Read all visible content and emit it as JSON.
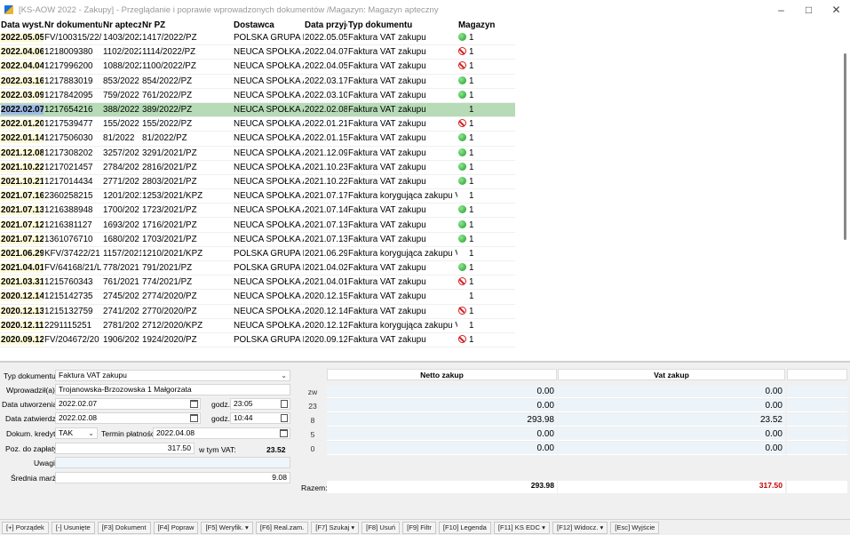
{
  "window": {
    "title": "[KS-AOW 2022 - Zakupy] - Przeglądanie i poprawie wprowadzonych dokumentów /Magazyn: Magazyn apteczny"
  },
  "grid": {
    "headers": [
      "Data wyst.",
      "Nr dokumentu",
      "Nr aptecz",
      "Nr PZ",
      "Dostawca",
      "Data przyję",
      "Typ dokumentu",
      "Magazyn"
    ],
    "rows": [
      {
        "date": "2022.05.05",
        "doc": "FV/100315/22/",
        "apt": "1403/2022",
        "pz": "1417/2022/PZ",
        "sup": "POLSKA GRUPA F",
        "recv": "2022.05.05",
        "type": "Faktura VAT zakupu",
        "status": "ok",
        "mag": "1"
      },
      {
        "date": "2022.04.06",
        "doc": "1218009380",
        "apt": "1102/2022",
        "pz": "1114/2022/PZ",
        "sup": "NEUCA SPÓŁKA A",
        "recv": "2022.04.07",
        "type": "Faktura VAT zakupu",
        "status": "no",
        "mag": "1"
      },
      {
        "date": "2022.04.04",
        "doc": "1217996200",
        "apt": "1088/2022",
        "pz": "1100/2022/PZ",
        "sup": "NEUCA SPÓŁKA A",
        "recv": "2022.04.05",
        "type": "Faktura VAT zakupu",
        "status": "no",
        "mag": "1"
      },
      {
        "date": "2022.03.16",
        "doc": "1217883019",
        "apt": "853/2022",
        "pz": "854/2022/PZ",
        "sup": "NEUCA SPÓŁKA A",
        "recv": "2022.03.17",
        "type": "Faktura VAT zakupu",
        "status": "ok",
        "mag": "1"
      },
      {
        "date": "2022.03.09",
        "doc": "1217842095",
        "apt": "759/2022",
        "pz": "761/2022/PZ",
        "sup": "NEUCA SPÓŁKA A",
        "recv": "2022.03.10",
        "type": "Faktura VAT zakupu",
        "status": "ok",
        "mag": "1"
      },
      {
        "date": "2022.02.07",
        "doc": "1217654216",
        "apt": "388/2022",
        "pz": "389/2022/PZ",
        "sup": "NEUCA SPÓŁKA A",
        "recv": "2022.02.08",
        "type": "Faktura VAT zakupu",
        "status": "none",
        "mag": "1",
        "selected": true
      },
      {
        "date": "2022.01.20",
        "doc": "1217539477",
        "apt": "155/2022",
        "pz": "155/2022/PZ",
        "sup": "NEUCA SPÓŁKA A",
        "recv": "2022.01.21",
        "type": "Faktura VAT zakupu",
        "status": "no",
        "mag": "1"
      },
      {
        "date": "2022.01.14",
        "doc": "1217506030",
        "apt": "81/2022",
        "pz": "81/2022/PZ",
        "sup": "NEUCA SPÓŁKA A",
        "recv": "2022.01.15",
        "type": "Faktura VAT zakupu",
        "status": "ok",
        "mag": "1"
      },
      {
        "date": "2021.12.08",
        "doc": "1217308202",
        "apt": "3257/202",
        "pz": "3291/2021/PZ",
        "sup": "NEUCA SPÓŁKA A",
        "recv": "2021.12.09",
        "type": "Faktura VAT zakupu",
        "status": "ok",
        "mag": "1"
      },
      {
        "date": "2021.10.22",
        "doc": "1217021457",
        "apt": "2784/202",
        "pz": "2816/2021/PZ",
        "sup": "NEUCA SPÓŁKA A",
        "recv": "2021.10.23",
        "type": "Faktura VAT zakupu",
        "status": "ok",
        "mag": "1"
      },
      {
        "date": "2021.10.21",
        "doc": "1217014434",
        "apt": "2771/202",
        "pz": "2803/2021/PZ",
        "sup": "NEUCA SPÓŁKA A",
        "recv": "2021.10.22",
        "type": "Faktura VAT zakupu",
        "status": "ok",
        "mag": "1"
      },
      {
        "date": "2021.07.16",
        "doc": "2360258215",
        "apt": "1201/2021",
        "pz": "1253/2021/KPZ",
        "sup": "NEUCA SPÓŁKA A",
        "recv": "2021.07.17",
        "type": "Faktura korygująca zakupu VA",
        "status": "none",
        "mag": "1"
      },
      {
        "date": "2021.07.13",
        "doc": "1216388948",
        "apt": "1700/202",
        "pz": "1723/2021/PZ",
        "sup": "NEUCA SPÓŁKA A",
        "recv": "2021.07.14",
        "type": "Faktura VAT zakupu",
        "status": "ok",
        "mag": "1"
      },
      {
        "date": "2021.07.12",
        "doc": "1216381127",
        "apt": "1693/202",
        "pz": "1716/2021/PZ",
        "sup": "NEUCA SPÓŁKA A",
        "recv": "2021.07.13",
        "type": "Faktura VAT zakupu",
        "status": "ok",
        "mag": "1"
      },
      {
        "date": "2021.07.12",
        "doc": "1361076710",
        "apt": "1680/202",
        "pz": "1703/2021/PZ",
        "sup": "NEUCA SPÓŁKA A",
        "recv": "2021.07.13",
        "type": "Faktura VAT zakupu",
        "status": "ok",
        "mag": "1"
      },
      {
        "date": "2021.06.29",
        "doc": "KFV/37422/21",
        "apt": "1157/2021",
        "pz": "1210/2021/KPZ",
        "sup": "POLSKA GRUPA F",
        "recv": "2021.06.29",
        "type": "Faktura korygująca zakupu VA",
        "status": "none",
        "mag": "1"
      },
      {
        "date": "2021.04.01",
        "doc": "FV/64168/21/L",
        "apt": "778/2021",
        "pz": "791/2021/PZ",
        "sup": "POLSKA GRUPA F",
        "recv": "2021.04.02",
        "type": "Faktura VAT zakupu",
        "status": "ok",
        "mag": "1"
      },
      {
        "date": "2021.03.31",
        "doc": "1215760343",
        "apt": "761/2021",
        "pz": "774/2021/PZ",
        "sup": "NEUCA SPÓŁKA A",
        "recv": "2021.04.01",
        "type": "Faktura VAT zakupu",
        "status": "no",
        "mag": "1"
      },
      {
        "date": "2020.12.14",
        "doc": "1215142735",
        "apt": "2745/202",
        "pz": "2774/2020/PZ",
        "sup": "NEUCA SPÓŁKA A",
        "recv": "2020.12.15",
        "type": "Faktura VAT zakupu",
        "status": "none",
        "mag": "1"
      },
      {
        "date": "2020.12.13",
        "doc": "1215132759",
        "apt": "2741/202",
        "pz": "2770/2020/PZ",
        "sup": "NEUCA SPÓŁKA A",
        "recv": "2020.12.14",
        "type": "Faktura VAT zakupu",
        "status": "no",
        "mag": "1"
      },
      {
        "date": "2020.12.11",
        "doc": "2291115251",
        "apt": "2781/202",
        "pz": "2712/2020/KPZ",
        "sup": "NEUCA SPÓŁKA A",
        "recv": "2020.12.12",
        "type": "Faktura korygująca zakupu VA",
        "status": "none",
        "mag": "1"
      },
      {
        "date": "2020.09.12",
        "doc": "FV/204672/20",
        "apt": "1906/202",
        "pz": "1924/2020/PZ",
        "sup": "POLSKA GRUPA F",
        "recv": "2020.09.12",
        "type": "Faktura VAT zakupu",
        "status": "no",
        "mag": "1"
      }
    ]
  },
  "form": {
    "typ_label": "Typ dokumentu:",
    "typ_value": "Faktura VAT zakupu",
    "wprow_label": "Wprowadził(a):",
    "wprow_value": "Trojanowska-Brzozowska 1 Małgorzata",
    "utw_label": "Data utworzenia:",
    "utw_value": "2022.02.07",
    "utw_godz_label": "godz.:",
    "utw_godz": "23:05",
    "zatw_label": "Data zatwierdz.:",
    "zatw_value": "2022.02.08",
    "zatw_godz_label": "godz.:",
    "zatw_godz": "10:44",
    "kred_label": "Dokum. kredyt:",
    "kred_value": "TAK",
    "termin_label": "Termin płatności:",
    "termin_value": "2022.04.08",
    "poz_label": "Poz. do zapłaty:",
    "poz_value": "317.50",
    "vat_label": "w tym VAT:",
    "vat_value": "23.52",
    "uwagi_label": "Uwagi:",
    "uwagi_value": "",
    "marza_label": "Średnia marża:",
    "marza_value": "9.08"
  },
  "vat": {
    "netto_header": "Netto zakup",
    "vat_header": "Vat zakup",
    "rows": [
      {
        "label": "zw",
        "netto": "0.00",
        "vat": "0.00"
      },
      {
        "label": "23",
        "netto": "0.00",
        "vat": "0.00"
      },
      {
        "label": "8",
        "netto": "293.98",
        "vat": "23.52"
      },
      {
        "label": "5",
        "netto": "0.00",
        "vat": "0.00"
      },
      {
        "label": "0",
        "netto": "0.00",
        "vat": "0.00"
      }
    ],
    "total_label": "Razem:",
    "total_netto": "293.98",
    "total_vat": "317.50",
    "total_vat_color": "#c00000"
  },
  "toolbar": {
    "buttons": [
      "[+] Porządek",
      "[-] Usunięte",
      "[F3] Dokument",
      "[F4] Popraw",
      "[F5] Weryfik. ▾",
      "[F6] Real.zam.",
      "[F7] Szukaj ▾",
      "[F8] Usuń",
      "[F9] Filtr",
      "[F10] Legenda",
      "[F11] KS EDC ▾",
      "[F12] Widocz. ▾",
      "[Esc] Wyjście"
    ]
  },
  "icons": {
    "app": "ks-aow-app-icon",
    "status_ok": "check-green-icon",
    "status_no": "no-entry-red-icon",
    "calendar": "calendar-icon",
    "spin": "spin-icon"
  }
}
